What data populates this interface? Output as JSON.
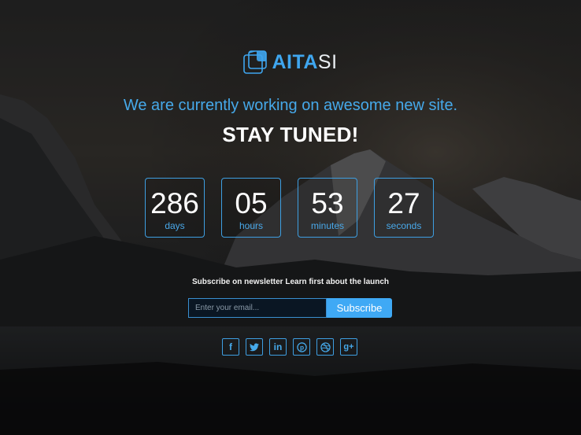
{
  "brand": {
    "name_bold": "AITA",
    "name_light": "SI"
  },
  "hero": {
    "tagline": "We are currently working on awesome new site.",
    "headline": "STAY TUNED!"
  },
  "countdown": [
    {
      "value": "286",
      "unit": "days"
    },
    {
      "value": "05",
      "unit": "hours"
    },
    {
      "value": "53",
      "unit": "minutes"
    },
    {
      "value": "27",
      "unit": "seconds"
    }
  ],
  "newsletter": {
    "text": "Subscribe on newsletter Learn first about the launch",
    "placeholder": "Enter your email...",
    "button": "Subscribe"
  },
  "social": [
    {
      "icon": "facebook-icon",
      "glyph": "f"
    },
    {
      "icon": "twitter-icon",
      "glyph": ""
    },
    {
      "icon": "linkedin-icon",
      "glyph": "in"
    },
    {
      "icon": "pinterest-icon",
      "glyph": "p"
    },
    {
      "icon": "dribbble-icon",
      "glyph": ""
    },
    {
      "icon": "google-plus-icon",
      "glyph": "g+"
    }
  ],
  "colors": {
    "accent": "#3fa9f5",
    "text": "#ffffff",
    "background": "#101215"
  }
}
